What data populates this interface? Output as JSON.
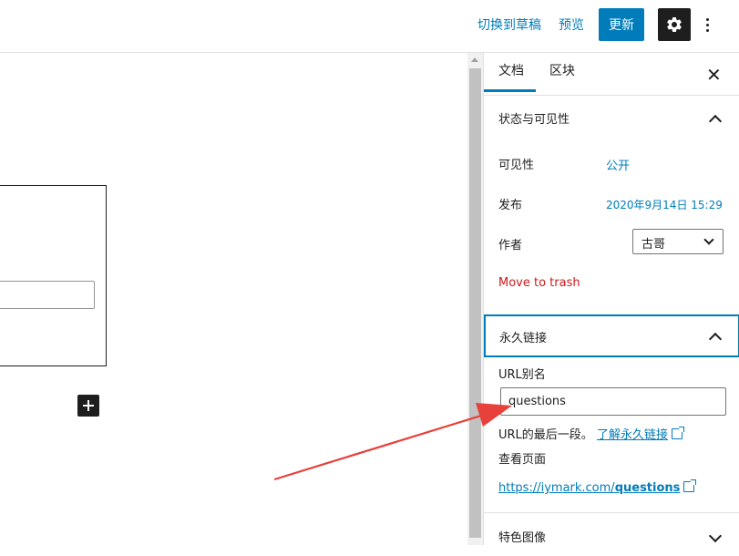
{
  "header": {
    "switch_draft_label": "切换到草稿",
    "preview_label": "预览",
    "update_label": "更新"
  },
  "sidebar": {
    "tabs": [
      {
        "label": "文档",
        "active": true
      },
      {
        "label": "区块",
        "active": false
      }
    ],
    "status_panel": {
      "title": "状态与可见性",
      "visibility_label": "可见性",
      "visibility_value": "公开",
      "publish_label": "发布",
      "publish_value": "2020年9月14日 15:29",
      "author_label": "作者",
      "author_value": "古哥",
      "trash_label": "Move to trash"
    },
    "permalink_panel": {
      "title": "永久链接",
      "slug_label": "URL别名",
      "slug_value": "questions",
      "help_text": "URL的最后一段。",
      "help_link": "了解永久链接",
      "view_label": "查看页面",
      "url_base": "https://iymark.com/",
      "url_slug": "questions"
    },
    "featured_panel": {
      "title": "特色图像"
    }
  },
  "colors": {
    "accent": "#007cba",
    "danger": "#cc1818",
    "annotation_arrow": "#e8403a"
  }
}
